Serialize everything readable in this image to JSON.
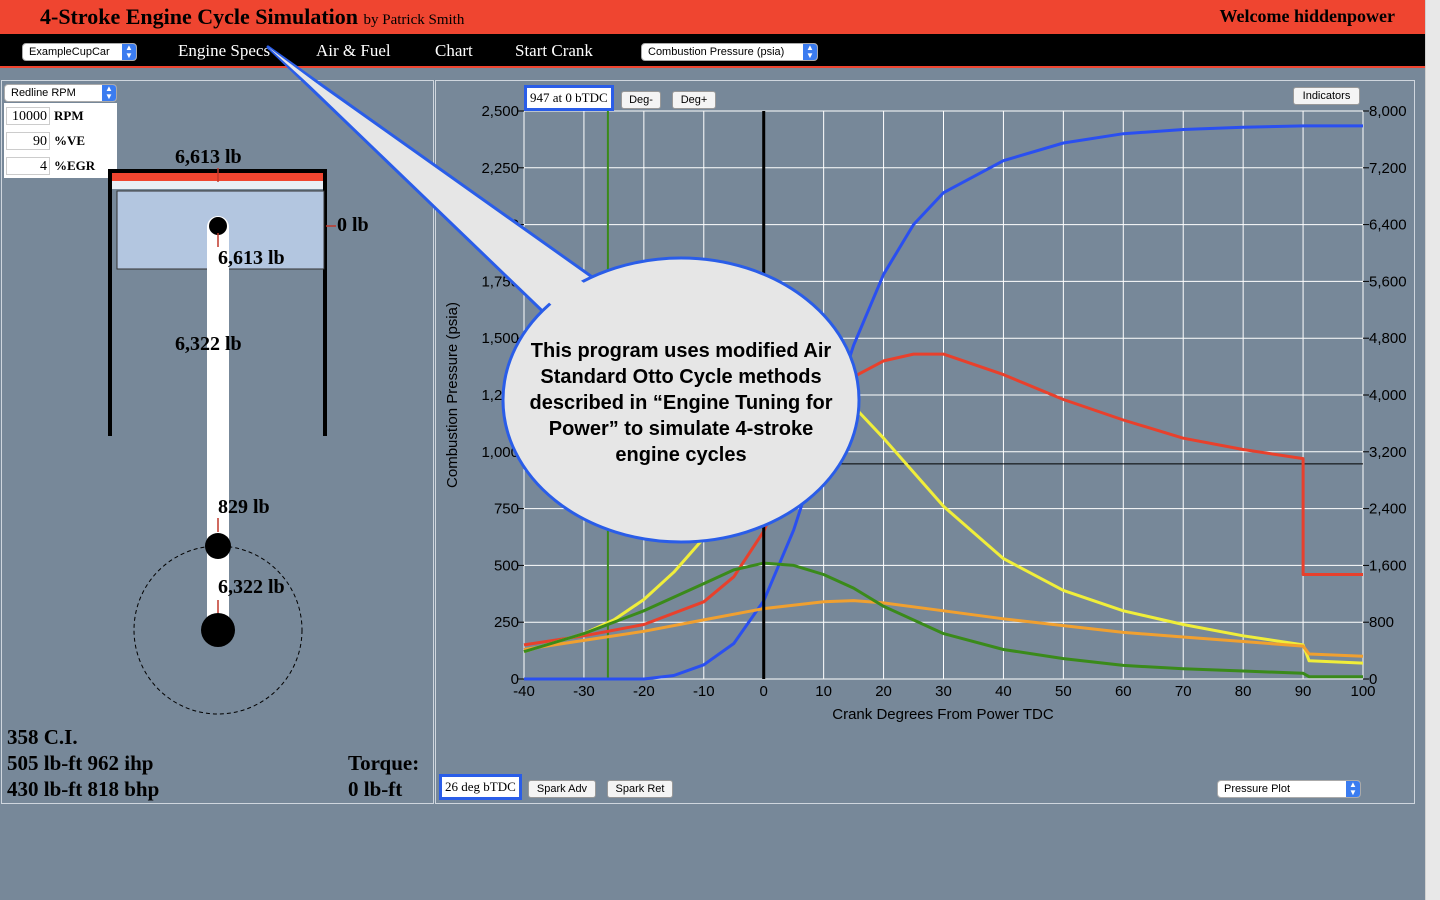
{
  "header": {
    "title": "4-Stroke Engine Cycle Simulation",
    "byline": "by Patrick Smith",
    "welcome": "Welcome hiddenpower"
  },
  "menu": {
    "car_select": "ExampleCupCar",
    "items": [
      "Engine Specs",
      "Air & Fuel",
      "Chart",
      "Start Crank"
    ],
    "plot_select": "Combustion Pressure (psia)"
  },
  "left": {
    "param_select": "Redline RPM",
    "inputs": [
      {
        "value": "10000",
        "unit": "RPM"
      },
      {
        "value": "90",
        "unit": "%VE"
      },
      {
        "value": "4",
        "unit": "%EGR"
      }
    ],
    "forces": {
      "piston_top": "6,613 lb",
      "wall": "0 lb",
      "wrist_pin": "6,613 lb",
      "rod": "6,322 lb",
      "big_end_top": "829 lb",
      "crank": "6,322 lb"
    },
    "stats": {
      "displacement": "358 C.I.",
      "peak_ihp": "505 lb-ft 962 ihp",
      "peak_bhp": "430 lb-ft 818 bhp",
      "torque_label": "Torque:",
      "torque_value": "0 lb-ft"
    }
  },
  "chart_panel": {
    "crank_readout": "947 at 0 bTDC",
    "deg_minus": "Deg-",
    "deg_plus": "Deg+",
    "indicators": "Indicators",
    "spark_readout": "26 deg bTDC",
    "spark_adv": "Spark Adv",
    "spark_ret": "Spark Ret",
    "plot_mode": "Pressure Plot"
  },
  "callout": "This program uses modified Air Standard Otto Cycle methods described in “Engine Tuning for Power” to simulate 4-stroke engine cycles",
  "chart_data": {
    "type": "line",
    "xlabel": "Crank Degrees From Power TDC",
    "ylabel": "Combustion Pressure (psia)",
    "xlim": [
      -40,
      100
    ],
    "ylim": [
      0,
      2500
    ],
    "y2lim": [
      0,
      8000
    ],
    "xticks": [
      -40,
      -30,
      -20,
      -10,
      0,
      10,
      20,
      30,
      40,
      50,
      60,
      70,
      80,
      90,
      100
    ],
    "yticks": [
      "0",
      "250",
      "500",
      "750",
      "1,000",
      "1,250",
      "1,500",
      "1,750",
      "2,000",
      "2,250",
      "2,500"
    ],
    "y2ticks": [
      "0",
      "800",
      "1,600",
      "2,400",
      "3,200",
      "4,000",
      "4,800",
      "5,600",
      "6,400",
      "7,200",
      "8,000"
    ],
    "grid": true,
    "spark_marker_x": -26,
    "cursor_x": 0,
    "reference_y": 947,
    "series": [
      {
        "color": "#2a4ff0",
        "axis": "right",
        "x": [
          -40,
          -30,
          -20,
          -15,
          -10,
          -5,
          0,
          5,
          10,
          15,
          20,
          25,
          30,
          40,
          50,
          60,
          70,
          80,
          90,
          100
        ],
        "y": [
          0,
          0,
          0,
          50,
          200,
          500,
          1100,
          2100,
          3400,
          4700,
          5700,
          6400,
          6850,
          7300,
          7550,
          7680,
          7740,
          7770,
          7790,
          7790
        ]
      },
      {
        "color": "#e8402c",
        "axis": "left",
        "x": [
          -40,
          -30,
          -20,
          -10,
          -5,
          0,
          5,
          10,
          15,
          20,
          25,
          30,
          40,
          50,
          60,
          70,
          80,
          90,
          90,
          91,
          100
        ],
        "y": [
          150,
          190,
          240,
          340,
          450,
          650,
          950,
          1200,
          1330,
          1400,
          1430,
          1430,
          1340,
          1230,
          1140,
          1060,
          1010,
          970,
          460,
          460,
          460
        ]
      },
      {
        "color": "#f0ee3a",
        "axis": "left",
        "x": [
          -40,
          -30,
          -25,
          -20,
          -15,
          -10,
          -5,
          0,
          5,
          10,
          15,
          20,
          30,
          40,
          50,
          60,
          70,
          80,
          90,
          91,
          100
        ],
        "y": [
          120,
          200,
          260,
          350,
          470,
          620,
          820,
          1050,
          1200,
          1260,
          1200,
          1060,
          760,
          530,
          390,
          300,
          240,
          190,
          150,
          80,
          70
        ]
      },
      {
        "color": "#f0a030",
        "axis": "left",
        "x": [
          -40,
          -30,
          -20,
          -10,
          0,
          10,
          15,
          20,
          30,
          40,
          50,
          60,
          70,
          80,
          90,
          91,
          100
        ],
        "y": [
          130,
          170,
          210,
          260,
          310,
          340,
          345,
          335,
          300,
          265,
          235,
          205,
          185,
          165,
          145,
          110,
          100
        ]
      },
      {
        "color": "#3a8a1a",
        "axis": "left",
        "x": [
          -40,
          -30,
          -20,
          -10,
          -5,
          0,
          5,
          10,
          15,
          20,
          30,
          40,
          50,
          60,
          70,
          80,
          90,
          91,
          100
        ],
        "y": [
          120,
          200,
          300,
          420,
          480,
          510,
          500,
          460,
          400,
          320,
          200,
          130,
          90,
          60,
          45,
          35,
          25,
          10,
          10
        ]
      }
    ]
  }
}
